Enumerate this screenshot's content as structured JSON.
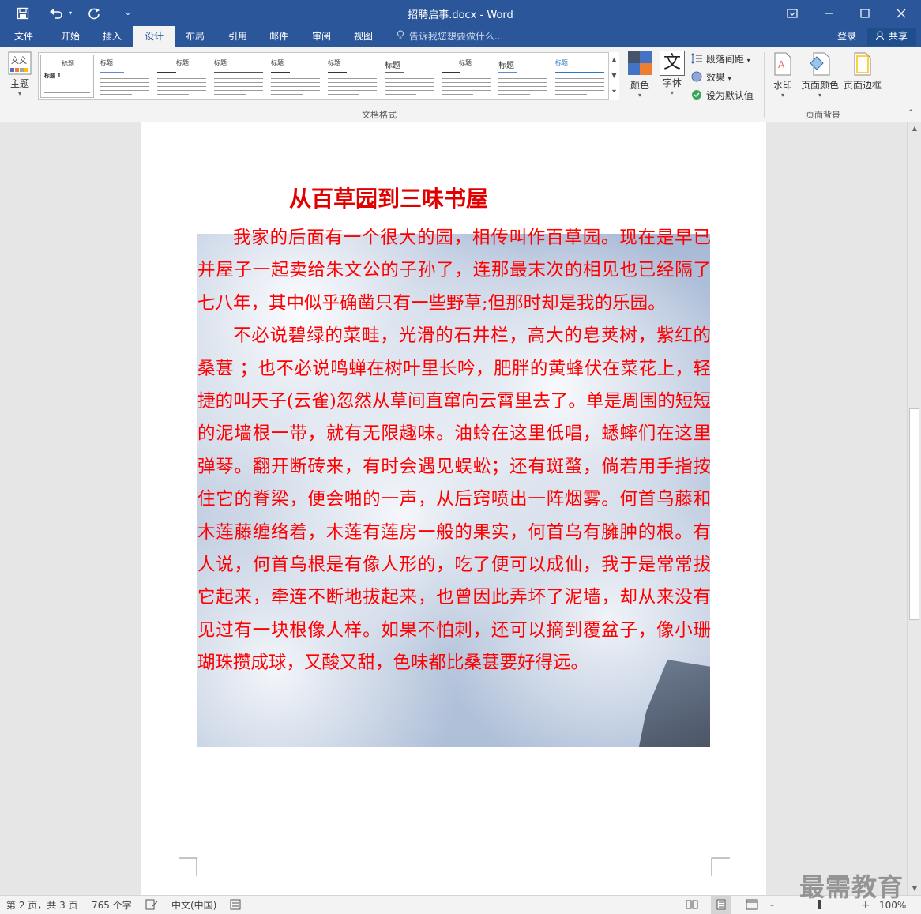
{
  "window": {
    "title": "招聘启事.docx - Word",
    "icons": {
      "save": "save-icon",
      "undo": "undo-icon",
      "redo": "redo-icon",
      "customize": "qat-dropdown-icon"
    }
  },
  "tabs": [
    "文件",
    "开始",
    "插入",
    "设计",
    "布局",
    "引用",
    "邮件",
    "审阅",
    "视图"
  ],
  "active_tab": "设计",
  "tellme_placeholder": "告诉我您想要做什么...",
  "account": {
    "login": "登录",
    "share": "共享"
  },
  "ribbon": {
    "theme_label": "主题",
    "gallery_headings": [
      "标题",
      "标题",
      "标题",
      "标题",
      "标题",
      "标题",
      "标题",
      "标题",
      "标题",
      "标题",
      "标题"
    ],
    "gallery_first_subtitle": "标题 1",
    "colors_label": "颜色",
    "fonts_label": "字体",
    "fonts_glyph": "文",
    "paragraph_spacing_label": "段落间距",
    "effects_label": "效果",
    "set_default_label": "设为默认值",
    "watermark_label": "水印",
    "page_color_label": "页面颜色",
    "page_border_label": "页面边框",
    "group_doc_format": "文档格式",
    "group_page_bg": "页面背景"
  },
  "document": {
    "heading": "从百草园到三味书屋",
    "paragraphs": [
      "我家的后面有一个很大的园，相传叫作百草园。现在是早已并屋子一起卖给朱文公的子孙了，连那最末次的相见也已经隔了七八年，其中似乎确凿只有一些野草;但那时却是我的乐园。",
      "不必说碧绿的菜畦，光滑的石井栏，高大的皂荚树，紫红的桑葚 ；也不必说鸣蝉在树叶里长吟，肥胖的黄蜂伏在菜花上，轻捷的叫天子(云雀)忽然从草间直窜向云霄里去了。单是周围的短短的泥墙根一带，就有无限趣味。油蛉在这里低唱，蟋蟀们在这里弹琴。翻开断砖来，有时会遇见蜈蚣；还有斑蝥，倘若用手指按住它的脊梁，便会啪的一声，从后窍喷出一阵烟雾。何首乌藤和木莲藤缠络着，木莲有莲房一般的果实，何首乌有臃肿的根。有人说，何首乌根是有像人形的，吃了便可以成仙，我于是常常拔它起来，牵连不断地拔起来，也曾因此弄坏了泥墙，却从来没有见过有一块根像人样。如果不怕刺，还可以摘到覆盆子，像小珊瑚珠攒成球，又酸又甜，色味都比桑葚要好得远。"
    ],
    "text_color": "#ff0000"
  },
  "status": {
    "page": "第 2 页，共 3 页",
    "words": "765 个字",
    "language": "中文(中国)",
    "zoom": "100%",
    "zoom_minus": "-",
    "zoom_plus": "+"
  },
  "logo_text": "最需教育",
  "colors": {
    "brand": "#2b579a",
    "ribbon_bg": "#f3f3f3",
    "doc_bg": "#e6e6e6",
    "text_red": "#ff0000"
  }
}
